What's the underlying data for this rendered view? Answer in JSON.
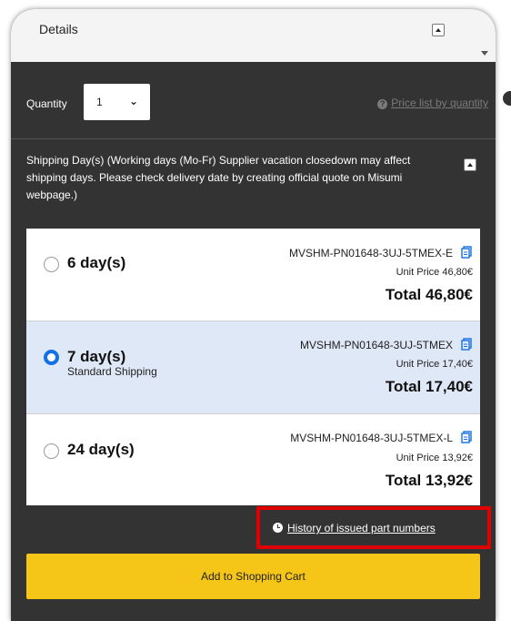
{
  "details": {
    "title": "Details"
  },
  "quantity": {
    "label": "Quantity",
    "value": "1"
  },
  "price_list": {
    "label": "Price list by quantity"
  },
  "shipping": {
    "description": "Shipping Day(s) (Working days (Mo-Fr) Supplier vacation closedown may affect shipping days. Please check delivery date by creating official quote on Misumi webpage.)",
    "options": [
      {
        "days": "6 day(s)",
        "sublabel": "",
        "part_number": "MVSHM-PN01648-3UJ-5TMEX-E",
        "unit_price": "Unit Price 46,80€",
        "total": "Total 46,80€",
        "selected": false
      },
      {
        "days": "7 day(s)",
        "sublabel": "Standard Shipping",
        "part_number": "MVSHM-PN01648-3UJ-5TMEX",
        "unit_price": "Unit Price 17,40€",
        "total": "Total 17,40€",
        "selected": true
      },
      {
        "days": "24 day(s)",
        "sublabel": "",
        "part_number": "MVSHM-PN01648-3UJ-5TMEX-L",
        "unit_price": "Unit Price 13,92€",
        "total": "Total 13,92€",
        "selected": false
      }
    ]
  },
  "history": {
    "label": "History of issued part numbers"
  },
  "cart": {
    "label": "Add to Shopping Cart"
  },
  "colors": {
    "panel": "#333333",
    "selected_row": "#dfe8f6",
    "radio_selected": "#1570e6",
    "cart_button": "#f5c518",
    "highlight_box": "#e00000"
  }
}
